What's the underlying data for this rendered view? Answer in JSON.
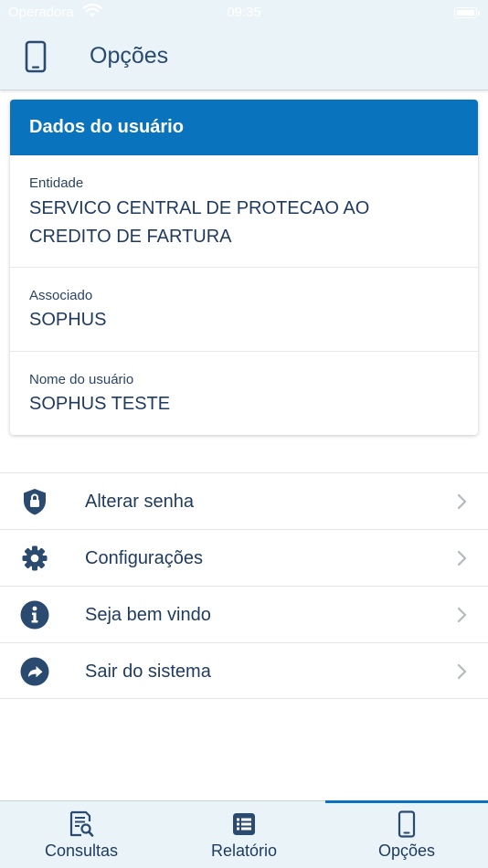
{
  "status_bar": {
    "carrier": "Operadora",
    "time": "09:35"
  },
  "header": {
    "title": "Opções",
    "icon": "smartphone-icon"
  },
  "user_card": {
    "title": "Dados do usuário",
    "fields": [
      {
        "label": "Entidade",
        "value_lines": [
          "SERVICO CENTRAL DE PROTECAO AO",
          "CREDITO DE FARTURA"
        ]
      },
      {
        "label": "Associado",
        "value_lines": [
          "SOPHUS"
        ]
      },
      {
        "label": "Nome do usuário",
        "value_lines": [
          "SOPHUS TESTE"
        ]
      }
    ]
  },
  "menu": [
    {
      "label": "Alterar senha",
      "icon": "shield-lock-icon"
    },
    {
      "label": "Configurações",
      "icon": "gear-icon"
    },
    {
      "label": "Seja bem vindo",
      "icon": "info-icon"
    },
    {
      "label": "Sair do sistema",
      "icon": "share-arrow-icon"
    }
  ],
  "tabs": [
    {
      "label": "Consultas",
      "icon": "document-search-icon",
      "active": false
    },
    {
      "label": "Relatório",
      "icon": "list-icon",
      "active": false
    },
    {
      "label": "Opções",
      "icon": "smartphone-icon",
      "active": true
    }
  ],
  "colors": {
    "accent": "#0a73bd",
    "text": "#1f3a5f",
    "bar_background": "#e9f3f8"
  }
}
